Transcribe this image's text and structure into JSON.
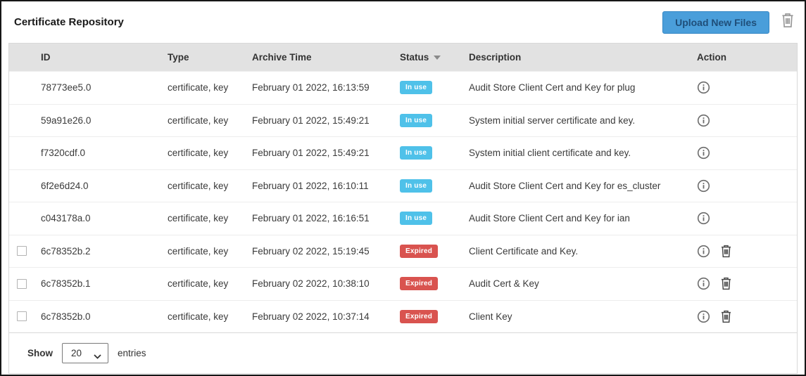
{
  "header": {
    "title": "Certificate Repository",
    "upload_button_label": "Upload New Files"
  },
  "table": {
    "columns": [
      "ID",
      "Type",
      "Archive Time",
      "Status",
      "Description",
      "Action"
    ],
    "sort": {
      "column": "Status",
      "direction": "desc"
    },
    "rows": [
      {
        "id": "78773ee5.0",
        "type": "certificate, key",
        "archive_time": "February 01 2022, 16:13:59",
        "status": "In use",
        "description": "Audit Store Client Cert and Key for plug",
        "selectable": false,
        "deletable": false
      },
      {
        "id": "59a91e26.0",
        "type": "certificate, key",
        "archive_time": "February 01 2022, 15:49:21",
        "status": "In use",
        "description": "System initial server certificate and key.",
        "selectable": false,
        "deletable": false
      },
      {
        "id": "f7320cdf.0",
        "type": "certificate, key",
        "archive_time": "February 01 2022, 15:49:21",
        "status": "In use",
        "description": "System initial client certificate and key.",
        "selectable": false,
        "deletable": false
      },
      {
        "id": "6f2e6d24.0",
        "type": "certificate, key",
        "archive_time": "February 01 2022, 16:10:11",
        "status": "In use",
        "description": "Audit Store Client Cert and Key for es_cluster",
        "selectable": false,
        "deletable": false
      },
      {
        "id": "c043178a.0",
        "type": "certificate, key",
        "archive_time": "February 01 2022, 16:16:51",
        "status": "In use",
        "description": "Audit Store Client Cert and Key for ian",
        "selectable": false,
        "deletable": false
      },
      {
        "id": "6c78352b.2",
        "type": "certificate, key",
        "archive_time": "February 02 2022, 15:19:45",
        "status": "Expired",
        "description": "Client Certificate and Key.",
        "selectable": true,
        "deletable": true
      },
      {
        "id": "6c78352b.1",
        "type": "certificate, key",
        "archive_time": "February 02 2022, 10:38:10",
        "status": "Expired",
        "description": "Audit Cert & Key",
        "selectable": true,
        "deletable": true
      },
      {
        "id": "6c78352b.0",
        "type": "certificate, key",
        "archive_time": "February 02 2022, 10:37:14",
        "status": "Expired",
        "description": "Client Key",
        "selectable": true,
        "deletable": true
      }
    ]
  },
  "footer": {
    "show_label": "Show",
    "entries_value": "20",
    "entries_label": "entries"
  },
  "colors": {
    "button_blue": "#4a9eda",
    "badge_in_use": "#4fc1e9",
    "badge_expired": "#d9534f",
    "header_gray": "#e2e2e2"
  }
}
